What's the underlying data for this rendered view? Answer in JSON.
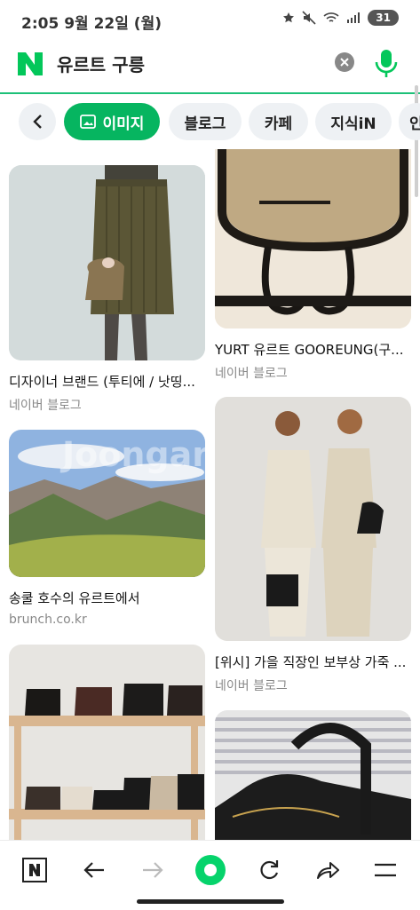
{
  "status_bar": {
    "time": "2:05  9월 22일 (월)",
    "battery": "31"
  },
  "search": {
    "query": "유르트 구릉",
    "brand_color": "#03c75a"
  },
  "tabs": [
    {
      "label": "이미지",
      "active": true
    },
    {
      "label": "블로그"
    },
    {
      "label": "카페"
    },
    {
      "label": "지식iN"
    },
    {
      "label": "인"
    }
  ],
  "results": [
    {
      "title": "디자이너 브랜드 (투티에 / 낫띵...",
      "source": "네이버 블로그"
    },
    {
      "title": "YURT 유르트 GOOREUNG(구...",
      "source": "네이버 블로그"
    },
    {
      "title": "송쿨 호수의 유르트에서",
      "source": "brunch.co.kr",
      "watermark": "Joongangilbo"
    },
    {
      "title": "[위시] 가을 직장인 보부상 가죽 ...",
      "source": "네이버 블로그"
    },
    {
      "title": "",
      "source": ""
    },
    {
      "title": "",
      "source": ""
    }
  ],
  "bottom_nav": [
    "naver-home",
    "back",
    "forward",
    "green-dot",
    "refresh",
    "share",
    "menu"
  ]
}
